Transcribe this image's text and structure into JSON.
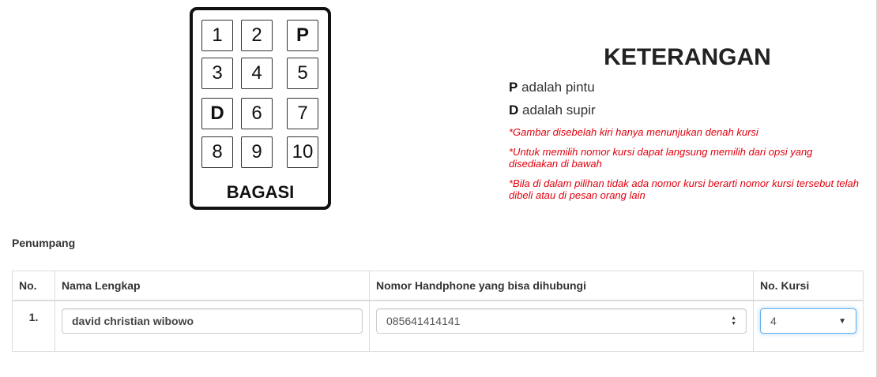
{
  "seat_map": {
    "seats": [
      {
        "label": "1",
        "bold": false
      },
      {
        "label": "2",
        "bold": false
      },
      {
        "label": "P",
        "bold": true
      },
      {
        "label": "3",
        "bold": false
      },
      {
        "label": "4",
        "bold": false
      },
      {
        "label": "5",
        "bold": false
      },
      {
        "label": "D",
        "bold": true
      },
      {
        "label": "6",
        "bold": false
      },
      {
        "label": "7",
        "bold": false
      },
      {
        "label": "8",
        "bold": false
      },
      {
        "label": "9",
        "bold": false
      },
      {
        "label": "10",
        "bold": false
      }
    ],
    "footer": "BAGASI"
  },
  "keterangan": {
    "title": "KETERANGAN",
    "legend": [
      {
        "key": "P",
        "text": "adalah pintu"
      },
      {
        "key": "D",
        "text": "adalah supir"
      }
    ],
    "notes": [
      "*Gambar disebelah kiri hanya menunjukan denah kursi",
      "*Untuk memilih nomor kursi dapat langsung memilih dari opsi yang disediakan di bawah",
      "*Bila di dalam pilihan tidak ada nomor kursi berarti nomor kursi tersebut telah dibeli atau di pesan orang lain"
    ],
    "note_color": "#e0000e"
  },
  "penumpang": {
    "label": "Penumpang",
    "columns": [
      "No.",
      "Nama Lengkap",
      "Nomor Handphone yang bisa dihubungi",
      "No. Kursi"
    ],
    "rows": [
      {
        "no": "1.",
        "nama": "david christian wibowo",
        "phone": "085641414141",
        "kursi": "4"
      }
    ]
  }
}
